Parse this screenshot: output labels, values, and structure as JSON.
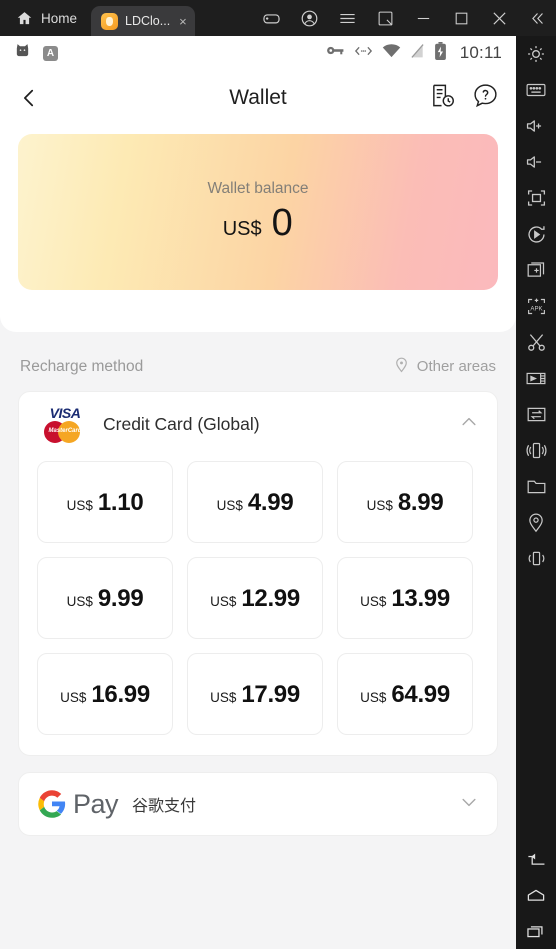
{
  "window": {
    "home_label": "Home",
    "tab_label": "LDClo...",
    "tab_close": "×",
    "tools": [
      "gamepad-icon",
      "account-icon",
      "menu-icon",
      "resize-icon",
      "minimize-icon",
      "maximize-icon",
      "close-icon",
      "collapse-icon"
    ]
  },
  "status_bar": {
    "app_badge": "A",
    "time": "10:11",
    "icons": [
      "cat-icon",
      "app-badge-icon",
      "vpn-key-icon",
      "adb-icon",
      "wifi-icon",
      "signal-off-icon",
      "battery-charging-icon"
    ]
  },
  "nav": {
    "back": "back-chevron-icon",
    "title": "Wallet",
    "history": "records-history-icon",
    "help": "help-question-icon"
  },
  "balance": {
    "label": "Wallet balance",
    "currency": "US$",
    "value": "0",
    "gradient_from": "#fdf3ce",
    "gradient_to": "#fbb9bd"
  },
  "recharge": {
    "section_title": "Recharge method",
    "other_areas": "Other areas",
    "location_icon": "location-pin-icon"
  },
  "methods": [
    {
      "name": "Credit Card (Global)",
      "logo": "visa-mastercard-logo",
      "visa_text": "VISA",
      "mastercard_text": "MasterCard",
      "expanded": true,
      "chevron": "chevron-up-icon",
      "tiles": [
        {
          "currency": "US$",
          "amount": "1.10"
        },
        {
          "currency": "US$",
          "amount": "4.99"
        },
        {
          "currency": "US$",
          "amount": "8.99"
        },
        {
          "currency": "US$",
          "amount": "9.99"
        },
        {
          "currency": "US$",
          "amount": "12.99"
        },
        {
          "currency": "US$",
          "amount": "13.99"
        },
        {
          "currency": "US$",
          "amount": "16.99"
        },
        {
          "currency": "US$",
          "amount": "17.99"
        },
        {
          "currency": "US$",
          "amount": "64.99"
        }
      ]
    },
    {
      "name": "谷歌支付",
      "logo": "google-pay-logo",
      "logo_text": "Pay",
      "expanded": false,
      "chevron": "chevron-down-icon",
      "tiles": []
    }
  ],
  "toolbar": {
    "top_items": [
      "settings-gear-icon",
      "keyboard-icon",
      "volume-up-icon",
      "volume-down-icon",
      "fullscreen-icon",
      "screen-record-icon",
      "add-window-icon",
      "install-apk-icon",
      "screenshot-scissors-icon",
      "video-icon",
      "file-transfer-icon",
      "shake-icon",
      "folder-icon",
      "location-icon",
      "vibrate-icon"
    ],
    "bottom_items": [
      "android-back-icon",
      "android-home-icon",
      "android-recents-icon"
    ]
  }
}
